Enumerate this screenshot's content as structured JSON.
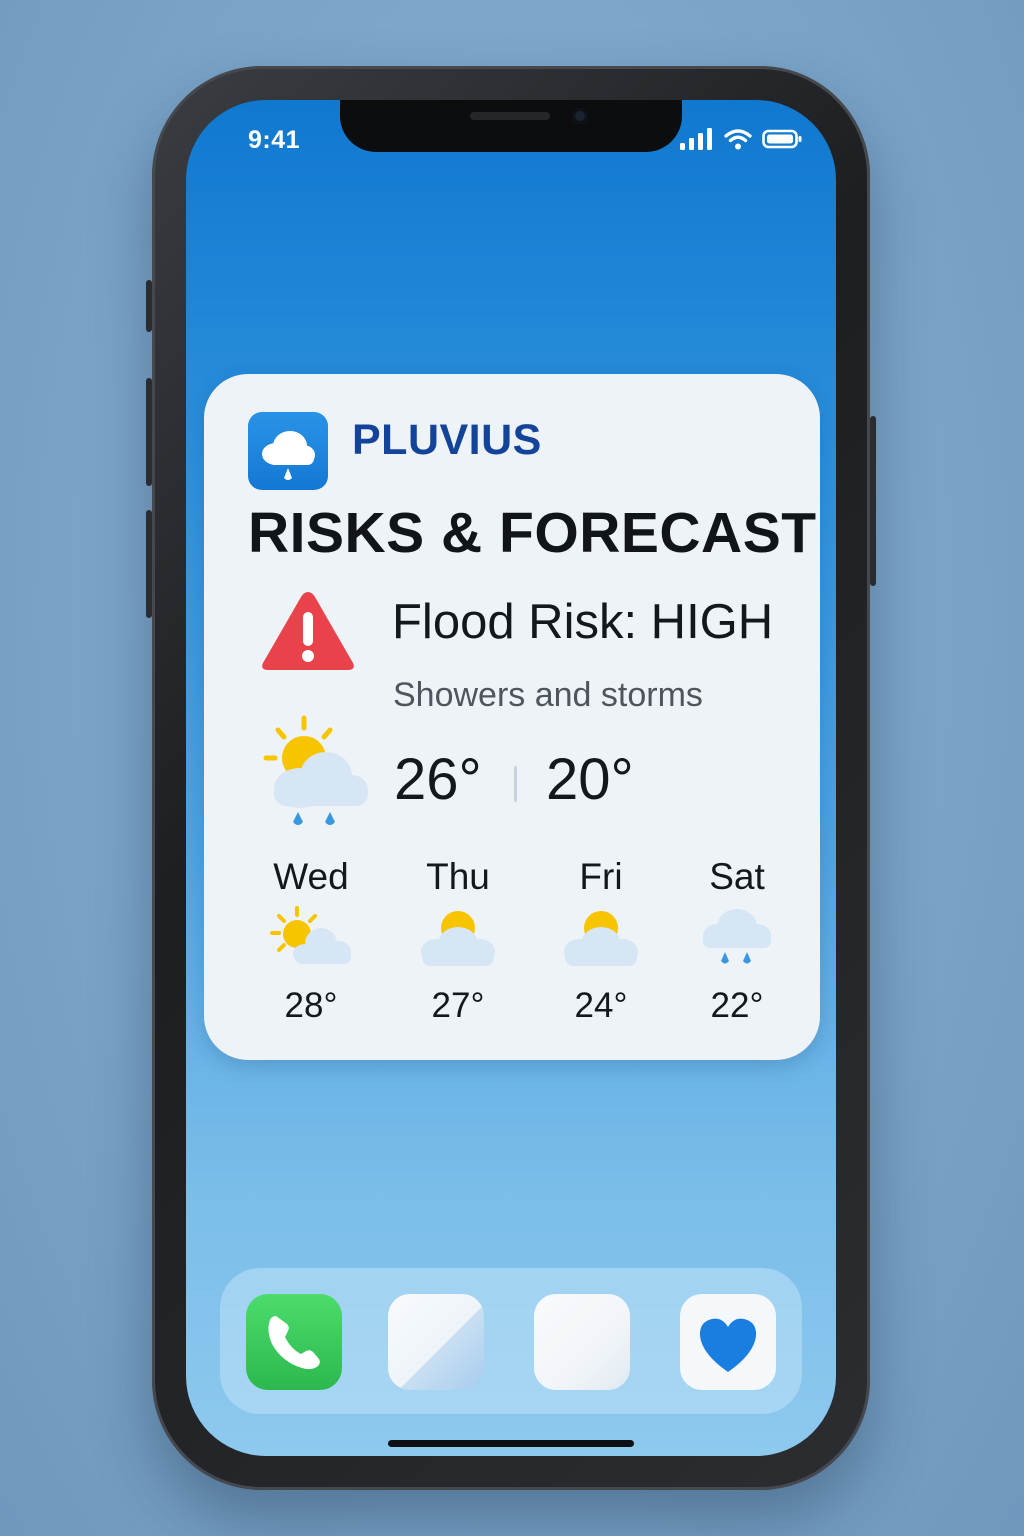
{
  "status_bar": {
    "time": "9:41",
    "icons": [
      "cellular-signal-icon",
      "wifi-icon",
      "battery-icon"
    ]
  },
  "widget": {
    "app_name": "PLUVIUS",
    "app_icon": "cloud-rain-icon",
    "title": "RISKS & FORECAST",
    "alert": {
      "icon": "warning-triangle-icon",
      "label": "Flood Risk: HIGH",
      "color": "#e8434a"
    },
    "current": {
      "condition": "Showers and storms",
      "icon": "sun-cloud-rain-icon",
      "high": "26°",
      "low": "20°"
    },
    "forecast": [
      {
        "day": "Wed",
        "icon": "sun-behind-cloud-icon",
        "temp": "28°"
      },
      {
        "day": "Thu",
        "icon": "sun-behind-cloud-icon",
        "temp": "27°"
      },
      {
        "day": "Fri",
        "icon": "sun-behind-cloud-icon",
        "temp": "24°"
      },
      {
        "day": "Sat",
        "icon": "rain-cloud-icon",
        "temp": "22°"
      }
    ]
  },
  "dock": {
    "apps": [
      {
        "name": "phone-icon",
        "color": "#34c759"
      },
      {
        "name": "blank-app-icon",
        "color": "#f2f6fa"
      },
      {
        "name": "blank-app-icon",
        "color": "#f2f6fa"
      },
      {
        "name": "heart-icon",
        "color": "#1a7ee0"
      }
    ]
  },
  "colors": {
    "brand": "#13449a",
    "accent": "#1478d4",
    "sun": "#f7c400",
    "cloud": "#d6e6f4",
    "rain": "#3a98e0"
  }
}
